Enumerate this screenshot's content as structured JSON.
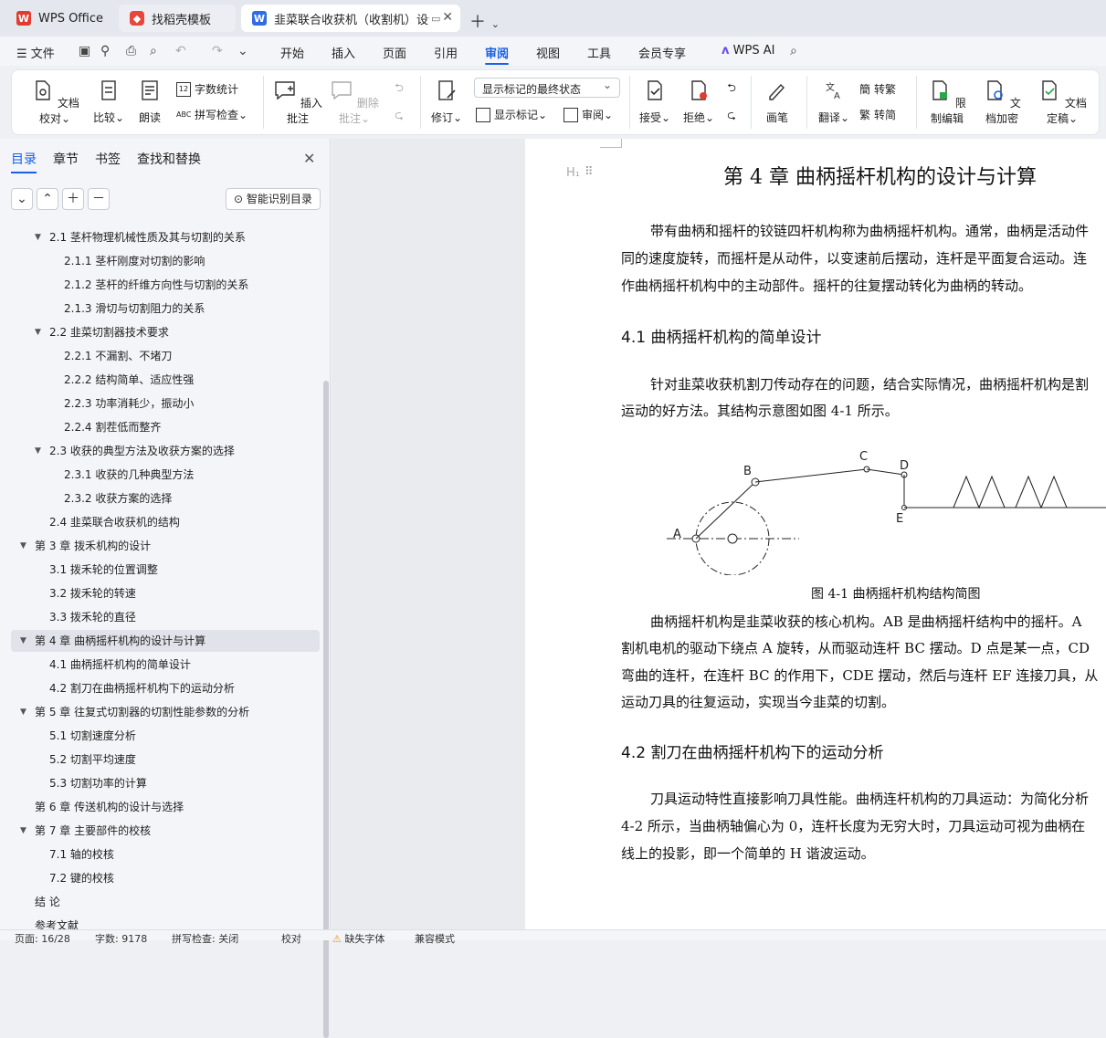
{
  "tabs": [
    {
      "label": "WPS Office"
    },
    {
      "label": "找稻壳模板"
    },
    {
      "label": "韭菜联合收获机（收割机）设计"
    }
  ],
  "menu": {
    "file": "文件",
    "items": [
      "开始",
      "插入",
      "页面",
      "引用",
      "审阅",
      "视图",
      "工具",
      "会员专享"
    ],
    "active": "审阅",
    "wps_ai": "WPS AI"
  },
  "ribbon": {
    "doc_check": "文档校对",
    "compare": "比较",
    "read_aloud": "朗读",
    "word_count": "字数统计",
    "spell_check": "拼写检查",
    "insert_comment": "插入批注",
    "delete_comment": "删除批注",
    "revise": "修订",
    "markup_dropdown": "显示标记的最终状态",
    "show_markup": "显示标记",
    "review": "审阅",
    "accept": "接受",
    "reject": "拒绝",
    "pen": "画笔",
    "translate": "翻译",
    "to_traditional": "转繁",
    "to_simplified": "转简",
    "restrict_edit": "限制编辑",
    "encrypt": "文档加密",
    "finalize": "文档定稿"
  },
  "sidebar": {
    "tabs": [
      "目录",
      "章节",
      "书签",
      "查找和替换"
    ],
    "smart_toc": "智能识别目录",
    "toc": [
      {
        "text": "2.1 茎杆物理机械性质及其与切割的关系",
        "level": 2,
        "caret": true
      },
      {
        "text": "2.1.1 茎杆刚度对切割的影响",
        "level": 3
      },
      {
        "text": "2.1.2 茎杆的纤维方向性与切割的关系",
        "level": 3
      },
      {
        "text": "2.1.3 滑切与切割阻力的关系",
        "level": 3
      },
      {
        "text": "2.2 韭菜切割器技术要求",
        "level": 2,
        "caret": true
      },
      {
        "text": "2.2.1 不漏割、不堵刀",
        "level": 3
      },
      {
        "text": "2.2.2 结构简单、适应性强",
        "level": 3
      },
      {
        "text": "2.2.3 功率消耗少，振动小",
        "level": 3
      },
      {
        "text": "2.2.4 割茬低而整齐",
        "level": 3
      },
      {
        "text": "2.3 收获的典型方法及收获方案的选择",
        "level": 2,
        "caret": true
      },
      {
        "text": "2.3.1 收获的几种典型方法",
        "level": 3
      },
      {
        "text": "2.3.2 收获方案的选择",
        "level": 3
      },
      {
        "text": "2.4 韭菜联合收获机的结构",
        "level": 2
      },
      {
        "text": "第 3 章  拨禾机构的设计",
        "level": 1,
        "caret": true
      },
      {
        "text": "3.1 拨禾轮的位置调整",
        "level": 2
      },
      {
        "text": "3.2 拨禾轮的转速",
        "level": 2
      },
      {
        "text": "3.3  拨禾轮的直径",
        "level": 2
      },
      {
        "text": "第 4 章  曲柄摇杆机构的设计与计算",
        "level": 1,
        "caret": true,
        "selected": true
      },
      {
        "text": "4.1 曲柄摇杆机构的简单设计",
        "level": 2
      },
      {
        "text": "4.2 割刀在曲柄摇杆机构下的运动分析",
        "level": 2
      },
      {
        "text": "第 5 章  往复式切割器的切割性能参数的分析",
        "level": 1,
        "caret": true
      },
      {
        "text": "5.1 切割速度分析",
        "level": 2
      },
      {
        "text": "5.2 切割平均速度",
        "level": 2
      },
      {
        "text": "5.3 切割功率的计算",
        "level": 2
      },
      {
        "text": "第 6 章  传送机构的设计与选择",
        "level": 1
      },
      {
        "text": "第 7 章  主要部件的校核",
        "level": 1,
        "caret": true
      },
      {
        "text": "7.1 轴的校核",
        "level": 2
      },
      {
        "text": "7.2 键的校核",
        "level": 2
      },
      {
        "text": "结    论",
        "level": 1
      },
      {
        "text": "参考文献",
        "level": 1
      }
    ]
  },
  "document": {
    "heading_marker": "H₁",
    "title": "第 4 章  曲柄摇杆机构的设计与计算",
    "para1": [
      "带有曲柄和摇杆的铰链四杆机构称为曲柄摇杆机构。通常，曲柄是活动件",
      "同的速度旋转，而摇杆是从动件，以变速前后摆动，连杆是平面复合运动。连",
      "作曲柄摇杆机构中的主动部件。摇杆的往复摆动转化为曲柄的转动。"
    ],
    "h41": "4.1 曲柄摇杆机构的简单设计",
    "para2": [
      "针对韭菜收获机割刀传动存在的问题，结合实际情况，曲柄摇杆机构是割",
      "运动的好方法。其结构示意图如图 4-1 所示。"
    ],
    "figure_labels": [
      "A",
      "B",
      "C",
      "D",
      "E"
    ],
    "figure_caption": "图 4-1 曲柄摇杆机构结构简图",
    "para3": [
      "曲柄摇杆机构是韭菜收获的核心机构。AB 是曲柄摇杆结构中的摇杆。A",
      "割机电机的驱动下绕点 A 旋转，从而驱动连杆 BC 摆动。D 点是某一点，CD",
      "弯曲的连杆，在连杆 BC 的作用下，CDE 摆动，然后与连杆 EF 连接刀具，从",
      "运动刀具的往复运动，实现当今韭菜的切割。"
    ],
    "h42": "4.2 割刀在曲柄摇杆机构下的运动分析",
    "para4": [
      "刀具运动特性直接影响刀具性能。曲柄连杆机构的刀具运动：为简化分析",
      "4-2 所示，当曲柄轴偏心为 0，连杆长度为无穷大时，刀具运动可视为曲柄在",
      "线上的投影，即一个简单的 H 谐波运动。"
    ]
  },
  "status": {
    "page": "页面: 16/28",
    "words": "字数: 9178",
    "spell": "拼写检查: 关闭",
    "proof": "校对",
    "missing_font": "缺失字体",
    "compat": "兼容模式"
  },
  "colors": {
    "accent": "#1760e8",
    "wps_red": "#e33b2f"
  }
}
